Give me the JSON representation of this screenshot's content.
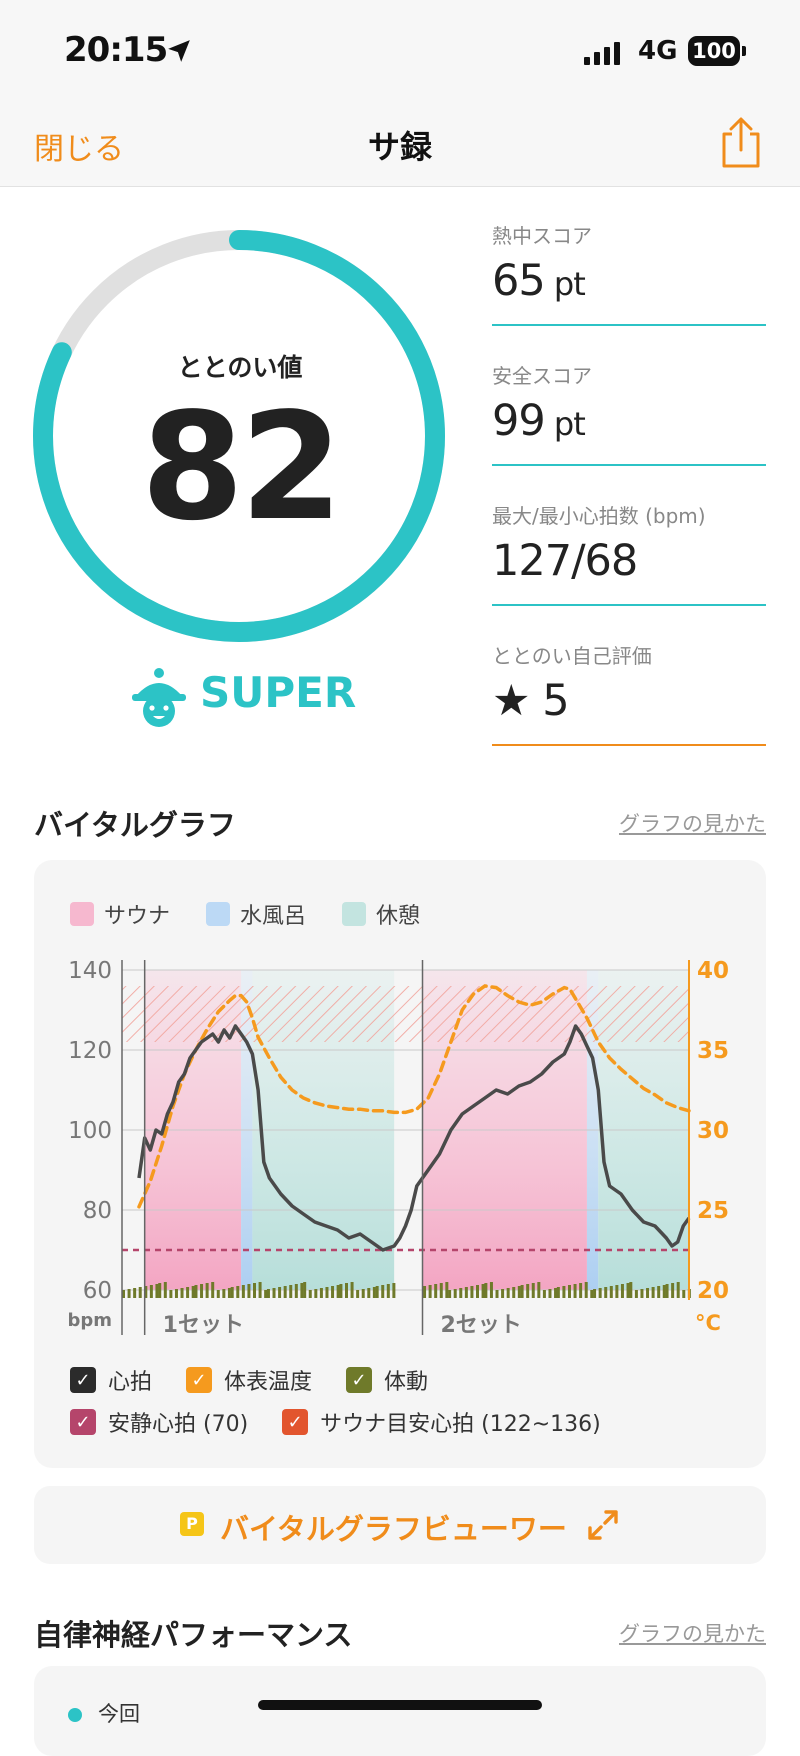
{
  "status_bar": {
    "time": "20:15",
    "network": "4G",
    "battery": "100"
  },
  "nav": {
    "close": "閉じる",
    "title": "サ録"
  },
  "score": {
    "label": "ととのい値",
    "value": "82",
    "progress": 0.82,
    "level": "SUPER"
  },
  "metrics": [
    {
      "label": "熱中スコア",
      "value": "65",
      "unit": " pt"
    },
    {
      "label": "安全スコア",
      "value": "99",
      "unit": " pt"
    },
    {
      "label": "最大/最小心拍数 (bpm)",
      "value": "127/68",
      "unit": ""
    },
    {
      "label": "ととのい自己評価",
      "value": "★ 5",
      "unit": ""
    }
  ],
  "vital_section": {
    "title": "バイタルグラフ",
    "help_link": "グラフの見かた"
  },
  "chart_legend": [
    {
      "label": "サウナ",
      "color": "#f6b8cf"
    },
    {
      "label": "水風呂",
      "color": "#bcd9f5"
    },
    {
      "label": "休憩",
      "color": "#c3e4e0"
    }
  ],
  "chart_data": {
    "type": "line",
    "x_tick_labels": [
      "1セット",
      "2セット"
    ],
    "y_left": {
      "ticks": [
        140,
        120,
        100,
        80,
        60
      ],
      "unit": "bpm",
      "range": [
        60,
        140
      ]
    },
    "y_right": {
      "ticks": [
        40,
        35,
        30,
        25,
        20
      ],
      "unit": "°C",
      "range": [
        20,
        40
      ]
    },
    "x_range": [
      0,
      100
    ],
    "segments": [
      {
        "type": "sauna",
        "start": 4,
        "end": 21
      },
      {
        "type": "cold",
        "start": 21,
        "end": 23
      },
      {
        "type": "rest",
        "start": 23,
        "end": 48
      },
      {
        "type": "sauna",
        "start": 53,
        "end": 82
      },
      {
        "type": "cold",
        "start": 82,
        "end": 84
      },
      {
        "type": "rest",
        "start": 84,
        "end": 100
      }
    ],
    "target_zone": [
      122,
      136
    ],
    "resting_hr": 70,
    "series": [
      {
        "name": "心拍",
        "color": "#4a4a4a",
        "points": [
          [
            3,
            88
          ],
          [
            4,
            98
          ],
          [
            5,
            95
          ],
          [
            6,
            100
          ],
          [
            7,
            99
          ],
          [
            8,
            104
          ],
          [
            9,
            107
          ],
          [
            10,
            112
          ],
          [
            11,
            114
          ],
          [
            12,
            118
          ],
          [
            13,
            120
          ],
          [
            14,
            122
          ],
          [
            15,
            123
          ],
          [
            16,
            124
          ],
          [
            17,
            122
          ],
          [
            18,
            125
          ],
          [
            19,
            123
          ],
          [
            20,
            126
          ],
          [
            21,
            124
          ],
          [
            22,
            122
          ],
          [
            23,
            119
          ],
          [
            24,
            110
          ],
          [
            25,
            92
          ],
          [
            26,
            88
          ],
          [
            28,
            84
          ],
          [
            30,
            81
          ],
          [
            32,
            79
          ],
          [
            34,
            77
          ],
          [
            36,
            76
          ],
          [
            38,
            75
          ],
          [
            40,
            73
          ],
          [
            42,
            74
          ],
          [
            44,
            72
          ],
          [
            46,
            70
          ],
          [
            48,
            71
          ],
          [
            49,
            73
          ],
          [
            50,
            76
          ],
          [
            51,
            80
          ],
          [
            52,
            86
          ],
          [
            53,
            88
          ],
          [
            54,
            90
          ],
          [
            56,
            94
          ],
          [
            58,
            100
          ],
          [
            60,
            104
          ],
          [
            62,
            106
          ],
          [
            64,
            108
          ],
          [
            66,
            110
          ],
          [
            68,
            109
          ],
          [
            70,
            111
          ],
          [
            72,
            112
          ],
          [
            74,
            114
          ],
          [
            76,
            117
          ],
          [
            78,
            119
          ],
          [
            79,
            122
          ],
          [
            80,
            126
          ],
          [
            81,
            124
          ],
          [
            82,
            121
          ],
          [
            83,
            118
          ],
          [
            84,
            110
          ],
          [
            85,
            92
          ],
          [
            86,
            86
          ],
          [
            88,
            84
          ],
          [
            90,
            80
          ],
          [
            92,
            77
          ],
          [
            94,
            76
          ],
          [
            96,
            73
          ],
          [
            97,
            71
          ],
          [
            98,
            72
          ],
          [
            99,
            76
          ],
          [
            100,
            78
          ]
        ]
      },
      {
        "name": "体表温度",
        "color": "#f59a1e",
        "points": [
          [
            3,
            25.2
          ],
          [
            5,
            26.8
          ],
          [
            7,
            29
          ],
          [
            9,
            31.5
          ],
          [
            11,
            33.5
          ],
          [
            13,
            35
          ],
          [
            15,
            36.3
          ],
          [
            17,
            37.4
          ],
          [
            19,
            38.1
          ],
          [
            20,
            38.4
          ],
          [
            21,
            38.4
          ],
          [
            22,
            38
          ],
          [
            23,
            37
          ],
          [
            24,
            35.8
          ],
          [
            26,
            34.5
          ],
          [
            28,
            33.3
          ],
          [
            30,
            32.5
          ],
          [
            32,
            32
          ],
          [
            34,
            31.7
          ],
          [
            36,
            31.5
          ],
          [
            38,
            31.4
          ],
          [
            40,
            31.3
          ],
          [
            42,
            31.3
          ],
          [
            44,
            31.2
          ],
          [
            46,
            31.2
          ],
          [
            48,
            31.1
          ],
          [
            50,
            31.1
          ],
          [
            52,
            31.3
          ],
          [
            54,
            32
          ],
          [
            56,
            33.5
          ],
          [
            58,
            35.5
          ],
          [
            60,
            37.5
          ],
          [
            62,
            38.5
          ],
          [
            64,
            39
          ],
          [
            66,
            38.9
          ],
          [
            68,
            38.4
          ],
          [
            70,
            38
          ],
          [
            72,
            37.8
          ],
          [
            74,
            38
          ],
          [
            76,
            38.5
          ],
          [
            78,
            38.9
          ],
          [
            79,
            38.8
          ],
          [
            80,
            38.2
          ],
          [
            82,
            37
          ],
          [
            84,
            35.5
          ],
          [
            86,
            34.5
          ],
          [
            88,
            33.8
          ],
          [
            90,
            33.2
          ],
          [
            92,
            32.6
          ],
          [
            94,
            32.2
          ],
          [
            96,
            31.7
          ],
          [
            98,
            31.4
          ],
          [
            100,
            31.2
          ]
        ]
      }
    ]
  },
  "chart_checks_row1": [
    {
      "label": "心拍",
      "color": "#2b2b2b"
    },
    {
      "label": "体表温度",
      "color": "#f59a1e"
    },
    {
      "label": "体動",
      "color": "#6f7a2a"
    }
  ],
  "chart_checks_row2": [
    {
      "label": "安静心拍 (70)",
      "color": "#b5456b"
    },
    {
      "label": "サウナ目安心拍 (122~136)",
      "color": "#e2552e"
    }
  ],
  "viewer": {
    "badge": "P",
    "label": "バイタルグラフビューワー"
  },
  "autonomic_section": {
    "title": "自律神経パフォーマンス",
    "help_link": "グラフの見かた"
  },
  "autonomic_legend": {
    "label": "今回"
  }
}
